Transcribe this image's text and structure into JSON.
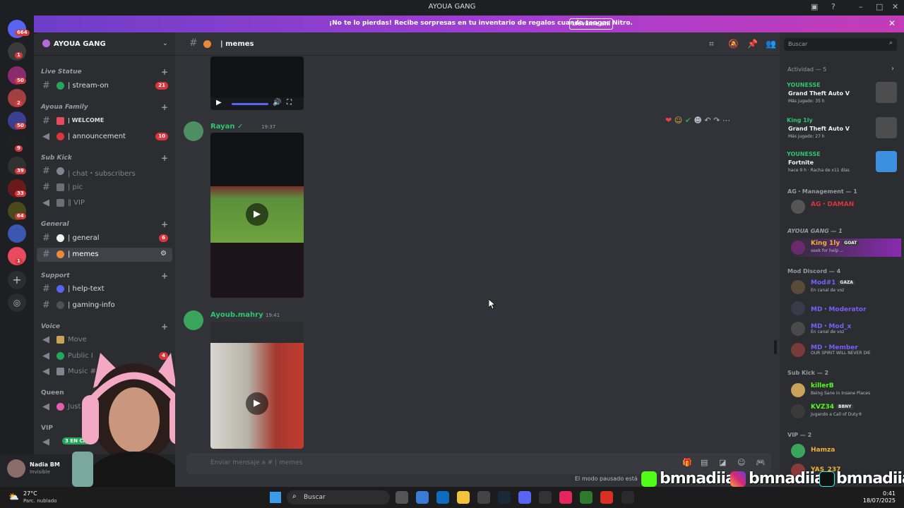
{
  "window": {
    "title": "AYOUA GANG"
  },
  "rail": {
    "badges": [
      "664",
      "1",
      "50",
      "2",
      "50",
      "9",
      "39",
      "33",
      "64",
      "1"
    ]
  },
  "banner": {
    "text": "¡No te lo pierdas! Recibe sorpresas en tu inventario de regalos cuando tengas Nitro.",
    "button": "Llévame ahí"
  },
  "guild": {
    "name": "AYOUA GANG"
  },
  "categories": [
    {
      "name": "Live Statue",
      "channels": [
        {
          "label": "| stream-on",
          "badge": "21"
        }
      ]
    },
    {
      "name": "Ayoua Family",
      "channels": [
        {
          "label": "| WELCOME",
          "badge": ""
        },
        {
          "label": "| announcement",
          "badge": "10"
        }
      ]
    },
    {
      "name": "Sub Kick",
      "channels": [
        {
          "label": "| chat・subscribers",
          "badge": ""
        },
        {
          "label": "| pic",
          "badge": ""
        },
        {
          "label": "‖ VIP",
          "badge": ""
        }
      ]
    },
    {
      "name": "General",
      "channels": [
        {
          "label": "| general",
          "badge": "6"
        },
        {
          "label": "| memes",
          "badge": ""
        }
      ]
    },
    {
      "name": "Support",
      "channels": [
        {
          "label": "| help-text",
          "badge": ""
        },
        {
          "label": "| gaming-info",
          "badge": ""
        }
      ]
    },
    {
      "name": "Voice",
      "channels": [
        {
          "label": "Move",
          "badge": ""
        },
        {
          "label": "Public I",
          "badge": "4"
        },
        {
          "label": "Music #1",
          "badge": ""
        }
      ]
    },
    {
      "name": "Queen",
      "channels": [
        {
          "label": "Just",
          "badge": ""
        }
      ]
    },
    {
      "name": "VIP",
      "channels": [
        {
          "label": "3 EN CA",
          "badge": ""
        }
      ]
    }
  ],
  "user": {
    "name": "Nadia BM",
    "status": "Invisible"
  },
  "chat": {
    "channel": "| memes",
    "composer_placeholder": "Enviar mensaje a # | memes",
    "paused": "El modo pausado está",
    "messages": [
      {
        "author": "Rayan ✓",
        "time": "19:37",
        "color": "#2dc770"
      },
      {
        "author": "Ayoub.mahry",
        "time": "19:41",
        "color": "#2dc770"
      }
    ]
  },
  "members": {
    "search_placeholder": "Buscar",
    "activity_header": "Actividad — 5",
    "activities": [
      {
        "user": "YOUNESSE",
        "game": "Grand Theft Auto V",
        "meta": "Más jugado: 35 h"
      },
      {
        "user": "King 1ly",
        "game": "Grand Theft Auto V",
        "meta": "Más jugado: 27 h"
      },
      {
        "user": "YOUNESSE",
        "game": "Fortnite",
        "meta": "hace 9 h · Racha de x11 días"
      }
    ],
    "sections": [
      {
        "title": "AG・Management — 1",
        "members": [
          {
            "name": "AG・DAMAN",
            "status": "",
            "color": "#da373c"
          }
        ]
      },
      {
        "title": "AYOUA GANG — 1",
        "members": [
          {
            "name": "King 1ly",
            "status": "seek for help ...",
            "color": "#f0b232",
            "tag": "GOAT"
          }
        ]
      },
      {
        "title": "Mod Discord — 4",
        "members": [
          {
            "name": "Mod#1",
            "status": "En canal de voz",
            "color": "#7c5cff",
            "tag": "GAZA"
          },
          {
            "name": "MD・Moderator",
            "status": "",
            "color": "#7c5cff"
          },
          {
            "name": "MD・Mod_x",
            "status": "En canal de voz",
            "color": "#7c5cff"
          },
          {
            "name": "MD・Member",
            "status": "OUR SPIRIT WILL NEVER DIE",
            "color": "#7c5cff"
          }
        ]
      },
      {
        "title": "Sub Kick — 2",
        "members": [
          {
            "name": "killerB",
            "status": "Being Sane in Insane Places",
            "color": "#53fc18"
          },
          {
            "name": "KVZ34",
            "status": "Jugando a Call of Duty®",
            "color": "#53fc18",
            "tag": "BBNY"
          }
        ]
      },
      {
        "title": "VIP — 2",
        "members": [
          {
            "name": "Hamza",
            "status": "",
            "color": "#f0b232"
          },
          {
            "name": "YAS_237",
            "status": "",
            "color": "#f0b232"
          }
        ]
      }
    ]
  },
  "taskbar": {
    "weather_temp": "27°C",
    "weather_desc": "Parc. nublado",
    "search_placeholder": "Buscar",
    "time": "0:41",
    "date": "18/07/2025"
  },
  "overlay": {
    "handle": "bmnadiia"
  }
}
